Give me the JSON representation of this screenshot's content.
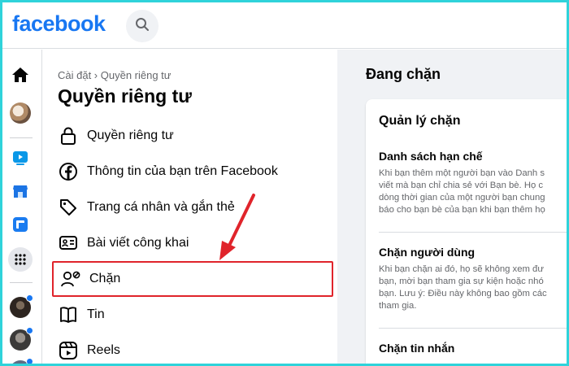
{
  "app": {
    "logo": "facebook"
  },
  "colors": {
    "brand": "#1877f2",
    "highlight": "#e0242b",
    "frame": "#2fd3da"
  },
  "rail": {
    "items": [
      {
        "icon": "home-icon"
      },
      {
        "icon": "profile-avatar"
      },
      {
        "icon": "video-icon"
      },
      {
        "icon": "marketplace-icon"
      },
      {
        "icon": "gaming-icon"
      },
      {
        "icon": "menu-grid-icon"
      },
      {
        "icon": "shortcut-avatar",
        "badge": true
      },
      {
        "icon": "shortcut-avatar",
        "badge": true
      },
      {
        "icon": "shortcut-avatar",
        "badge": true
      }
    ]
  },
  "menu": {
    "breadcrumb": "Cài đặt › Quyền riêng tư",
    "title": "Quyền riêng tư",
    "items": [
      {
        "label": "Quyền riêng tư",
        "icon": "lock-icon"
      },
      {
        "label": "Thông tin của bạn trên Facebook",
        "icon": "facebook-icon"
      },
      {
        "label": "Trang cá nhân và gắn thẻ",
        "icon": "tag-icon"
      },
      {
        "label": "Bài viết công khai",
        "icon": "public-post-icon"
      },
      {
        "label": "Chặn",
        "icon": "block-user-icon",
        "selected": true
      },
      {
        "label": "Tin",
        "icon": "stories-icon"
      },
      {
        "label": "Reels",
        "icon": "reels-icon"
      }
    ]
  },
  "content": {
    "title": "Đang chặn",
    "card": {
      "title": "Quản lý chặn",
      "sections": [
        {
          "title": "Danh sách hạn chế",
          "lines": [
            "Khi bạn thêm một người bạn vào Danh s",
            "viết mà bạn chỉ chia sẻ với Bạn bè. Họ c",
            "dòng thời gian của một người bạn chung",
            "báo cho bạn bè của bạn khi bạn thêm họ"
          ]
        },
        {
          "title": "Chặn người dùng",
          "lines": [
            "Khi bạn chặn ai đó, họ sẽ không xem đư",
            "bạn, mời bạn tham gia sự kiện hoặc nhó",
            "bạn. Lưu ý: Điều này không bao gồm các",
            "tham gia."
          ]
        },
        {
          "title": "Chặn tin nhắn",
          "lines": []
        }
      ]
    }
  }
}
